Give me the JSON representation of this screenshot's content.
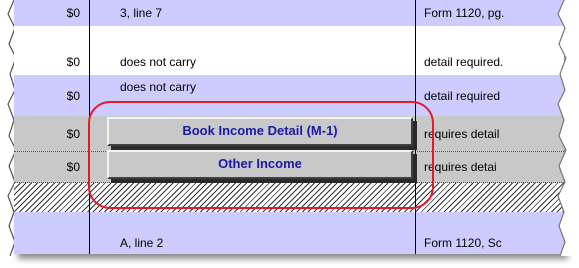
{
  "rows": [
    {
      "amount": "$0",
      "description": "3, line 7",
      "reference": "Form 1120, pg."
    },
    {
      "amount": "$0",
      "description": "does not carry",
      "reference": "detail required."
    },
    {
      "amount": "$0",
      "description": "does not carry",
      "reference": "detail required"
    },
    {
      "amount": "$0",
      "description": "",
      "reference": "requires detail"
    },
    {
      "amount": "$0",
      "description": "",
      "reference": "requires detai"
    },
    {
      "amount": "",
      "description": "A, line 2",
      "reference": "Form 1120, Sc"
    }
  ],
  "buttons": {
    "book_income": "Book Income Detail (M-1)",
    "other_income": "Other Income"
  },
  "colors": {
    "row_blue": "#ccccff",
    "row_gray": "#c8c8c8",
    "button_text": "#1a1aa8",
    "highlight": "#e21b2b"
  }
}
